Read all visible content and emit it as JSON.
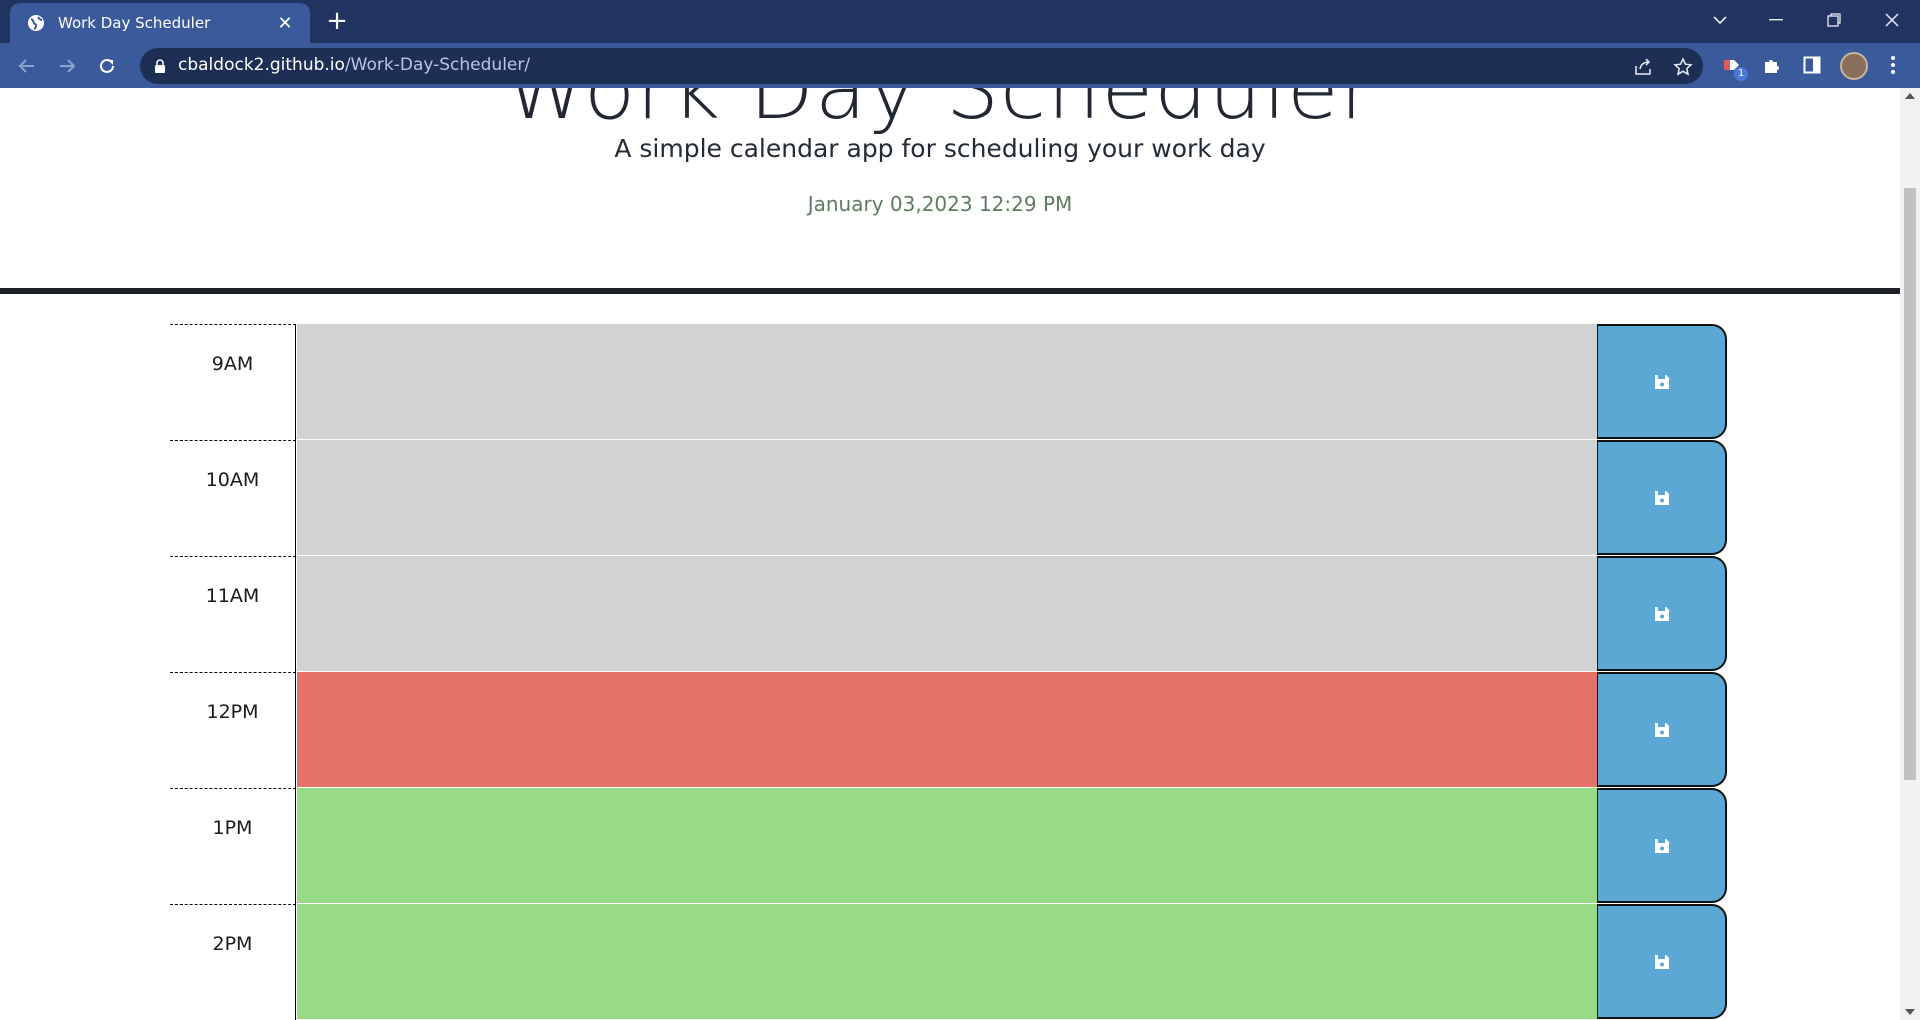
{
  "browser": {
    "tab_title": "Work Day Scheduler",
    "url_host": "cbaldock2.github.io",
    "url_path": "/Work-Day-Scheduler/",
    "extension_badge": "1"
  },
  "page": {
    "title": "Work Day Scheduler",
    "lead": "A simple calendar app for scheduling your work day",
    "current_day": "January 03,2023 12:29 PM"
  },
  "colors": {
    "past": "#d3d3d3",
    "present": "#e37368",
    "future": "#98da86",
    "save_button": "#5ba8d4"
  },
  "time_blocks": [
    {
      "hour": "9AM",
      "status": "past",
      "text": ""
    },
    {
      "hour": "10AM",
      "status": "past",
      "text": ""
    },
    {
      "hour": "11AM",
      "status": "past",
      "text": ""
    },
    {
      "hour": "12PM",
      "status": "present",
      "text": ""
    },
    {
      "hour": "1PM",
      "status": "future",
      "text": ""
    },
    {
      "hour": "2PM",
      "status": "future",
      "text": ""
    }
  ]
}
